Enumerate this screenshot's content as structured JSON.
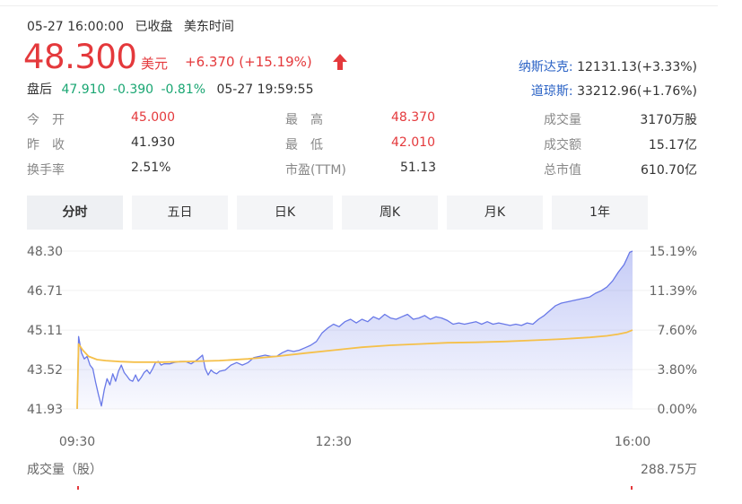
{
  "header": {
    "date_time": "05-27 16:00:00",
    "status": "已收盘",
    "timezone": "美东时间"
  },
  "price": {
    "current": "48.300",
    "currency": "美元",
    "change": "+6.370 (+15.19%)",
    "direction": "up",
    "color": "#e4393c"
  },
  "after_hours": {
    "label": "盘后",
    "price": "47.910",
    "change": "-0.390",
    "change_pct": "-0.81%",
    "time": "05-27 19:59:55",
    "color": "#19a672"
  },
  "indices": [
    {
      "name": "纳斯达克:",
      "value": "12131.13(+3.33%)"
    },
    {
      "name": "道琼斯:",
      "value": "33212.96(+1.76%)"
    }
  ],
  "stats": [
    {
      "label": "今　开",
      "value": "45.000",
      "highlight": true
    },
    {
      "label": "最　高",
      "value": "48.370",
      "highlight": true
    },
    {
      "label": "成交量",
      "value": "3170万股",
      "highlight": false
    },
    {
      "label": "昨　收",
      "value": "41.930",
      "highlight": false
    },
    {
      "label": "最　低",
      "value": "42.010",
      "highlight": true
    },
    {
      "label": "成交额",
      "value": "15.17亿",
      "highlight": false
    },
    {
      "label": "换手率",
      "value": "2.51%",
      "highlight": false
    },
    {
      "label": "市盈(TTM)",
      "value": "51.13",
      "highlight": false
    },
    {
      "label": "总市值",
      "value": "610.70亿",
      "highlight": false
    }
  ],
  "tabs": [
    {
      "label": "分时",
      "active": true
    },
    {
      "label": "五日",
      "active": false
    },
    {
      "label": "日K",
      "active": false
    },
    {
      "label": "周K",
      "active": false
    },
    {
      "label": "月K",
      "active": false
    },
    {
      "label": "1年",
      "active": false
    }
  ],
  "chart_data": {
    "type": "line",
    "y_ticks": [
      "48.30",
      "46.71",
      "45.11",
      "43.52",
      "41.93"
    ],
    "y_tick_values": [
      48.3,
      46.71,
      45.11,
      43.52,
      41.93
    ],
    "pct_ticks": [
      "15.19%",
      "11.39%",
      "7.60%",
      "3.80%",
      "0.00%"
    ],
    "ylim": [
      41.93,
      48.3
    ],
    "x_ticks": [
      "09:30",
      "12:30",
      "16:00"
    ],
    "x_tick_minutes": [
      0,
      180,
      390
    ],
    "xlim": [
      0,
      390
    ],
    "series": [
      {
        "color": "#6979e8",
        "area_fill": true,
        "points": [
          [
            0,
            41.93
          ],
          [
            1,
            44.85
          ],
          [
            3,
            44.2
          ],
          [
            5,
            43.95
          ],
          [
            7,
            44.05
          ],
          [
            9,
            43.7
          ],
          [
            11,
            43.55
          ],
          [
            13,
            43.0
          ],
          [
            15,
            42.5
          ],
          [
            17,
            42.05
          ],
          [
            19,
            42.7
          ],
          [
            21,
            43.15
          ],
          [
            23,
            42.9
          ],
          [
            25,
            43.35
          ],
          [
            27,
            43.05
          ],
          [
            29,
            43.45
          ],
          [
            31,
            43.7
          ],
          [
            33,
            43.4
          ],
          [
            35,
            43.25
          ],
          [
            37,
            43.1
          ],
          [
            39,
            43.05
          ],
          [
            41,
            43.3
          ],
          [
            43,
            43.05
          ],
          [
            45,
            43.2
          ],
          [
            47,
            43.4
          ],
          [
            49,
            43.5
          ],
          [
            51,
            43.35
          ],
          [
            53,
            43.55
          ],
          [
            55,
            43.8
          ],
          [
            57,
            43.85
          ],
          [
            59,
            43.7
          ],
          [
            61,
            43.75
          ],
          [
            63,
            43.75
          ],
          [
            65,
            43.75
          ],
          [
            68,
            43.8
          ],
          [
            72,
            43.85
          ],
          [
            76,
            43.85
          ],
          [
            80,
            43.75
          ],
          [
            84,
            43.9
          ],
          [
            88,
            44.1
          ],
          [
            90,
            43.55
          ],
          [
            92,
            43.3
          ],
          [
            94,
            43.5
          ],
          [
            96,
            43.4
          ],
          [
            98,
            43.35
          ],
          [
            100,
            43.45
          ],
          [
            104,
            43.5
          ],
          [
            108,
            43.7
          ],
          [
            112,
            43.8
          ],
          [
            116,
            43.7
          ],
          [
            120,
            43.8
          ],
          [
            124,
            44.0
          ],
          [
            128,
            44.05
          ],
          [
            132,
            44.1
          ],
          [
            136,
            44.05
          ],
          [
            140,
            44.05
          ],
          [
            144,
            44.2
          ],
          [
            148,
            44.3
          ],
          [
            152,
            44.25
          ],
          [
            156,
            44.3
          ],
          [
            160,
            44.4
          ],
          [
            164,
            44.5
          ],
          [
            168,
            44.65
          ],
          [
            172,
            45.0
          ],
          [
            176,
            45.2
          ],
          [
            180,
            45.35
          ],
          [
            184,
            45.25
          ],
          [
            188,
            45.45
          ],
          [
            192,
            45.55
          ],
          [
            196,
            45.4
          ],
          [
            200,
            45.55
          ],
          [
            204,
            45.45
          ],
          [
            208,
            45.65
          ],
          [
            212,
            45.55
          ],
          [
            216,
            45.75
          ],
          [
            220,
            45.6
          ],
          [
            224,
            45.55
          ],
          [
            228,
            45.65
          ],
          [
            232,
            45.75
          ],
          [
            236,
            45.55
          ],
          [
            240,
            45.6
          ],
          [
            244,
            45.7
          ],
          [
            248,
            45.55
          ],
          [
            252,
            45.65
          ],
          [
            256,
            45.6
          ],
          [
            260,
            45.5
          ],
          [
            264,
            45.35
          ],
          [
            268,
            45.4
          ],
          [
            272,
            45.35
          ],
          [
            276,
            45.4
          ],
          [
            280,
            45.45
          ],
          [
            284,
            45.35
          ],
          [
            288,
            45.45
          ],
          [
            292,
            45.35
          ],
          [
            296,
            45.4
          ],
          [
            300,
            45.35
          ],
          [
            304,
            45.3
          ],
          [
            308,
            45.35
          ],
          [
            312,
            45.3
          ],
          [
            316,
            45.4
          ],
          [
            320,
            45.35
          ],
          [
            324,
            45.55
          ],
          [
            328,
            45.7
          ],
          [
            332,
            45.9
          ],
          [
            336,
            46.1
          ],
          [
            340,
            46.2
          ],
          [
            344,
            46.25
          ],
          [
            348,
            46.3
          ],
          [
            352,
            46.35
          ],
          [
            356,
            46.4
          ],
          [
            360,
            46.45
          ],
          [
            364,
            46.6
          ],
          [
            368,
            46.7
          ],
          [
            372,
            46.85
          ],
          [
            376,
            47.1
          ],
          [
            380,
            47.45
          ],
          [
            384,
            47.75
          ],
          [
            386,
            48.0
          ],
          [
            388,
            48.25
          ],
          [
            390,
            48.3
          ]
        ]
      },
      {
        "color": "#f5c04a",
        "area_fill": false,
        "points": [
          [
            0,
            41.93
          ],
          [
            1,
            44.55
          ],
          [
            4,
            44.3
          ],
          [
            8,
            44.05
          ],
          [
            14,
            43.92
          ],
          [
            20,
            43.88
          ],
          [
            30,
            43.84
          ],
          [
            40,
            43.82
          ],
          [
            60,
            43.82
          ],
          [
            80,
            43.85
          ],
          [
            100,
            43.88
          ],
          [
            120,
            43.95
          ],
          [
            140,
            44.05
          ],
          [
            160,
            44.18
          ],
          [
            180,
            44.3
          ],
          [
            200,
            44.42
          ],
          [
            220,
            44.5
          ],
          [
            240,
            44.55
          ],
          [
            260,
            44.6
          ],
          [
            280,
            44.62
          ],
          [
            300,
            44.65
          ],
          [
            320,
            44.7
          ],
          [
            340,
            44.75
          ],
          [
            360,
            44.82
          ],
          [
            372,
            44.88
          ],
          [
            380,
            44.95
          ],
          [
            386,
            45.02
          ],
          [
            390,
            45.11
          ]
        ]
      }
    ]
  },
  "volume": {
    "label": "成交量（股）",
    "value": "288.75万"
  }
}
